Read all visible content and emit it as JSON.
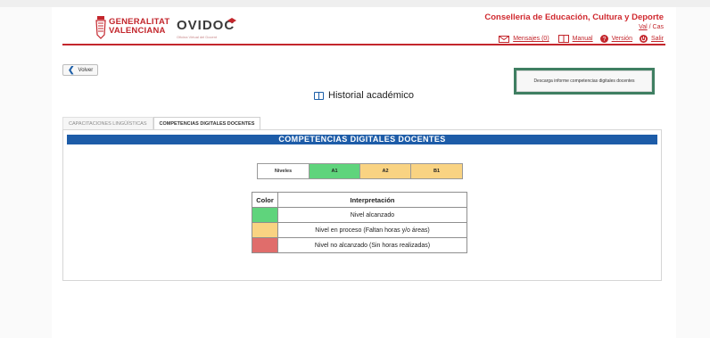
{
  "header": {
    "gv_logo_line1": "GENERALITAT",
    "gv_logo_line2": "VALENCIANA",
    "ovidoc_name": "OVIDOC",
    "ovidoc_subtitle": "Oficina Virtual del Docent",
    "org_title": "Conselleria de Educación, Cultura y Deporte",
    "lang_val": "Val",
    "lang_sep": "/",
    "lang_cas": "Cas",
    "mensajes_label": "Mensajes (0)",
    "manual_label": "Manual",
    "version_label": "Versión",
    "salir_label": "Salir"
  },
  "actions": {
    "volver_label": "Volver",
    "descarga_label": "Descarga informe competencias digitales docentes"
  },
  "page_title": "Historial académico",
  "tabs": [
    {
      "label": "CAPACITACIONES LINGÜÍSTICAS",
      "active": false
    },
    {
      "label": "COMPETENCIAS DIGITALES DOCENTES",
      "active": true
    }
  ],
  "panel": {
    "banner": "COMPETENCIAS DIGITALES DOCENTES",
    "levels_label": "Niveles",
    "levels": [
      {
        "name": "A1",
        "color": "#5fd47c"
      },
      {
        "name": "A2",
        "color": "#f9d382"
      },
      {
        "name": "B1",
        "color": "#f9d382"
      }
    ],
    "table_headers": {
      "color": "Color",
      "interpretation": "Interpretación"
    },
    "rows": [
      {
        "color": "#5fd47c",
        "text": "Nivel alcanzado"
      },
      {
        "color": "#f9d382",
        "text": "Nivel en proceso (Faltan horas y/o áreas)"
      },
      {
        "color": "#e06d6b",
        "text": "Nivel no alcanzado (Sin horas realizadas)"
      }
    ]
  },
  "colors": {
    "brand_red": "#c3262c",
    "banner_blue": "#1d5ca8",
    "highlight_green": "#3f7f62"
  }
}
